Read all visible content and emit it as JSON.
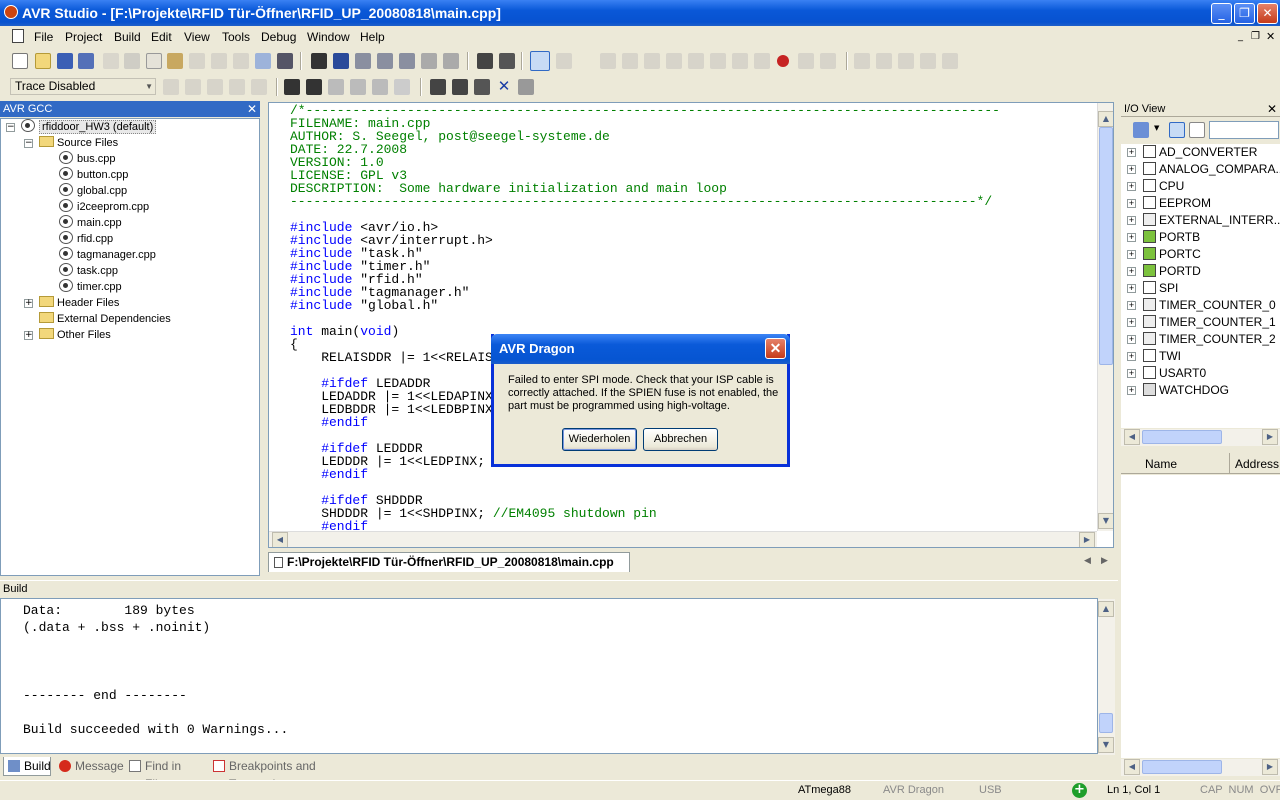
{
  "window": {
    "title": "AVR Studio - [F:\\Projekte\\RFID Tür-Öffner\\RFID_UP_20080818\\main.cpp]"
  },
  "menu": [
    "File",
    "Project",
    "Build",
    "Edit",
    "View",
    "Tools",
    "Debug",
    "Window",
    "Help"
  ],
  "toolbar": {
    "trace_select": "Trace Disabled"
  },
  "project_panel": {
    "title": "AVR GCC",
    "project": "rfiddoor_HW3 (default)",
    "source_folder": "Source Files",
    "files": [
      "bus.cpp",
      "button.cpp",
      "global.cpp",
      "i2ceeprom.cpp",
      "main.cpp",
      "rfid.cpp",
      "tagmanager.cpp",
      "task.cpp",
      "timer.cpp"
    ],
    "folders": [
      "Header Files",
      "External Dependencies",
      "Other Files"
    ]
  },
  "editor": {
    "lines": [
      {
        "c": "cm",
        "t": "/*-----------------------------------------------------------------------------------------"
      },
      {
        "c": "cm",
        "t": "FILENAME: main.cpp"
      },
      {
        "c": "cm",
        "t": "AUTHOR: S. Seegel, post@seegel-systeme.de"
      },
      {
        "c": "cm",
        "t": "DATE: 22.7.2008"
      },
      {
        "c": "cm",
        "t": "VERSION: 1.0"
      },
      {
        "c": "cm",
        "t": "LICENSE: GPL v3"
      },
      {
        "c": "cm",
        "t": "DESCRIPTION:  Some hardware initialization and main loop"
      },
      {
        "c": "cm",
        "t": "----------------------------------------------------------------------------------------*/"
      },
      {
        "c": "tx",
        "t": ""
      },
      {
        "c": "kw",
        "t": "#include",
        "r": " <avr/io.h>"
      },
      {
        "c": "kw",
        "t": "#include",
        "r": " <avr/interrupt.h>"
      },
      {
        "c": "kw",
        "t": "#include",
        "r": " \"task.h\""
      },
      {
        "c": "kw",
        "t": "#include",
        "r": " \"timer.h\""
      },
      {
        "c": "kw",
        "t": "#include",
        "r": " \"rfid.h\""
      },
      {
        "c": "kw",
        "t": "#include",
        "r": " \"tagmanager.h\""
      },
      {
        "c": "kw",
        "t": "#include",
        "r": " \"global.h\""
      },
      {
        "c": "tx",
        "t": ""
      },
      {
        "c": "kw",
        "t": "int",
        "r": " main(",
        "k2": "void",
        "r2": ")"
      },
      {
        "c": "tx",
        "t": "{"
      },
      {
        "c": "tx",
        "t": "    RELAISDDR |= 1<<RELAIS"
      },
      {
        "c": "tx",
        "t": ""
      },
      {
        "c": "kw",
        "t": "    #ifdef",
        "r": " LEDADDR"
      },
      {
        "c": "tx",
        "t": "    LEDADDR |= 1<<LEDAPINX"
      },
      {
        "c": "tx",
        "t": "    LEDBDDR |= 1<<LEDBPINX"
      },
      {
        "c": "kw",
        "t": "    #endif"
      },
      {
        "c": "tx",
        "t": ""
      },
      {
        "c": "kw",
        "t": "    #ifdef",
        "r": " LEDDDR"
      },
      {
        "c": "tx",
        "t": "    LEDDDR |= 1<<LEDPINX;"
      },
      {
        "c": "kw",
        "t": "    #endif"
      },
      {
        "c": "tx",
        "t": ""
      },
      {
        "c": "kw",
        "t": "    #ifdef",
        "r": " SHDDDR"
      },
      {
        "c": "tx",
        "t": "    SHDDDR |= 1<<SHDPINX; ",
        "cm": "//EM4095 shutdown pin"
      },
      {
        "c": "kw",
        "t": "    #endif"
      }
    ]
  },
  "doc_tab": "F:\\Projekte\\RFID Tür-Öffner\\RFID_UP_20080818\\main.cpp",
  "io_view": {
    "title": "I/O View",
    "items": [
      "AD_CONVERTER",
      "ANALOG_COMPARA...",
      "CPU",
      "EEPROM",
      "EXTERNAL_INTERR...",
      "PORTB",
      "PORTC",
      "PORTD",
      "SPI",
      "TIMER_COUNTER_0",
      "TIMER_COUNTER_1",
      "TIMER_COUNTER_2",
      "TWI",
      "USART0",
      "WATCHDOG"
    ],
    "columns": [
      "Name",
      "Address"
    ]
  },
  "build": {
    "title": "Build",
    "lines": [
      "Data:        189 bytes",
      "(.data + .bss + .noinit)",
      "",
      "",
      "",
      "-------- end --------",
      "",
      "Build succeeded with 0 Warnings..."
    ],
    "tabs": [
      "Build",
      "Message",
      "Find in Files",
      "Breakpoints and Tracepoints"
    ]
  },
  "dialog": {
    "title": "AVR Dragon",
    "message": "Failed to enter SPI mode. Check that your ISP cable is correctly attached. If the SPIEN fuse is not enabled, the part must be programmed using high-voltage.",
    "retry": "Wiederholen",
    "cancel": "Abbrechen"
  },
  "status": {
    "device": "ATmega88",
    "tool": "AVR Dragon",
    "port": "USB",
    "position": "Ln 1, Col 1",
    "keys": "CAP  NUM  OVR"
  }
}
